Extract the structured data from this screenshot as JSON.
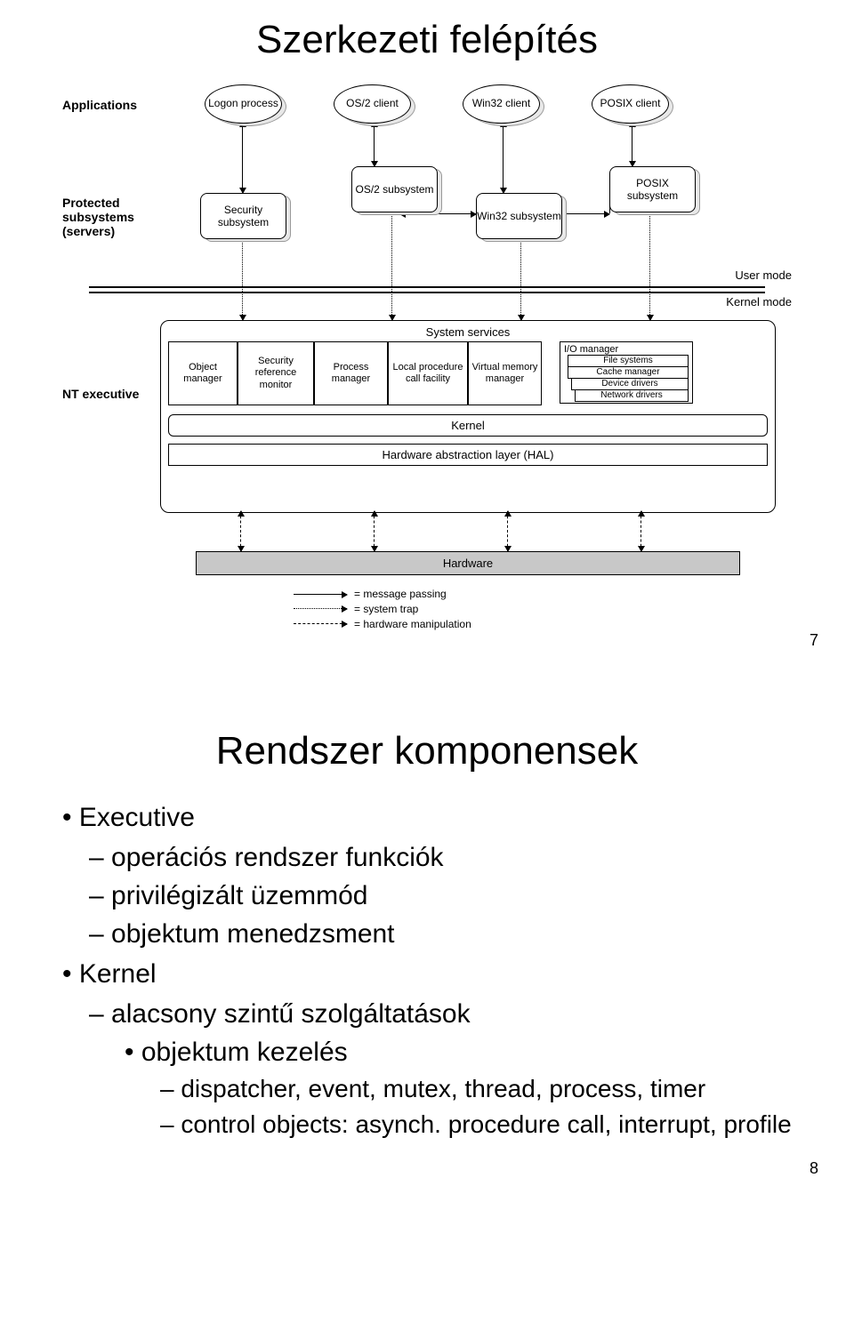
{
  "slide1": {
    "title": "Szerkezeti felépítés",
    "labels": {
      "applications": "Applications",
      "protected": "Protected\nsubsystems\n(servers)",
      "ntexec": "NT executive",
      "usermode": "User mode",
      "kernelmode": "Kernel mode"
    },
    "apps": {
      "logon": "Logon process",
      "os2client": "OS/2 client",
      "win32client": "Win32 client",
      "posixclient": "POSIX client"
    },
    "subs": {
      "security": "Security subsystem",
      "os2sub": "OS/2 subsystem",
      "win32sub": "Win32 subsystem",
      "posixsub": "POSIX subsystem"
    },
    "exec": {
      "services": "System services",
      "object": "Object manager",
      "secref": "Security reference monitor",
      "process": "Process manager",
      "lpc": "Local procedure call facility",
      "vmm": "Virtual memory manager",
      "io": "I/O manager",
      "fs": "File systems",
      "cache": "Cache manager",
      "devdrv": "Device drivers",
      "netdrv": "Network drivers",
      "kernel": "Kernel",
      "hal": "Hardware abstraction layer (HAL)"
    },
    "hardware": "Hardware",
    "legend": {
      "msg": "= message passing",
      "trap": "= system trap",
      "hw": "= hardware manipulation"
    },
    "pagenum": "7"
  },
  "slide2": {
    "title": "Rendszer komponensek",
    "items": {
      "exec": "Executive",
      "exec_os": "operációs rendszer funkciók",
      "exec_priv": "privilégizált üzemmód",
      "exec_obj": "objektum menedzsment",
      "kernel": "Kernel",
      "kernel_low": "alacsony szintű szolgáltatások",
      "kernel_objk": "objektum kezelés",
      "kernel_disp": "dispatcher, event, mutex, thread, process, timer",
      "kernel_ctrl": "control objects: asynch. procedure call, interrupt, profile"
    },
    "pagenum": "8"
  }
}
